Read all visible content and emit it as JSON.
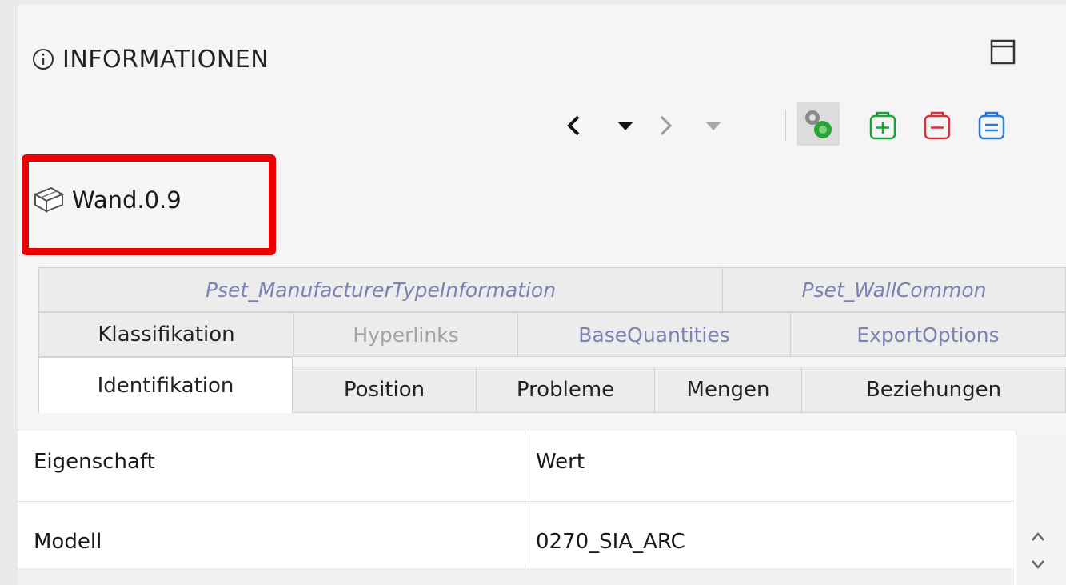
{
  "panel": {
    "title": "INFORMATIONEN",
    "object_name": "Wand.0.9"
  },
  "tabs": {
    "row1": [
      "Pset_ManufacturerTypeInformation",
      "Pset_WallCommon"
    ],
    "row2": [
      "Klassifikation",
      "Hyperlinks",
      "BaseQuantities",
      "ExportOptions"
    ],
    "row3": [
      "Identifikation",
      "Position",
      "Probleme",
      "Mengen",
      "Beziehungen"
    ],
    "active": "Identifikation"
  },
  "table": {
    "headers": [
      "Eigenschaft",
      "Wert"
    ],
    "rows": [
      {
        "property": "Modell",
        "value": "0270_SIA_ARC"
      }
    ]
  },
  "icons": {
    "title": "info-icon",
    "window": "maximize-icon",
    "toolbar": [
      "back-icon",
      "back-dropdown-icon",
      "forward-icon",
      "forward-dropdown-icon",
      "select-objects-icon",
      "add-to-set-icon",
      "remove-from-set-icon",
      "equal-set-icon"
    ],
    "object": "wall-icon"
  },
  "colors": {
    "highlight": "#ee0000",
    "link_tab_text": "#7a82b3",
    "disabled_tab_text": "#a3a3a3",
    "add_green": "#19a33a",
    "remove_red": "#d2333b",
    "equal_blue": "#2b7bd6"
  }
}
